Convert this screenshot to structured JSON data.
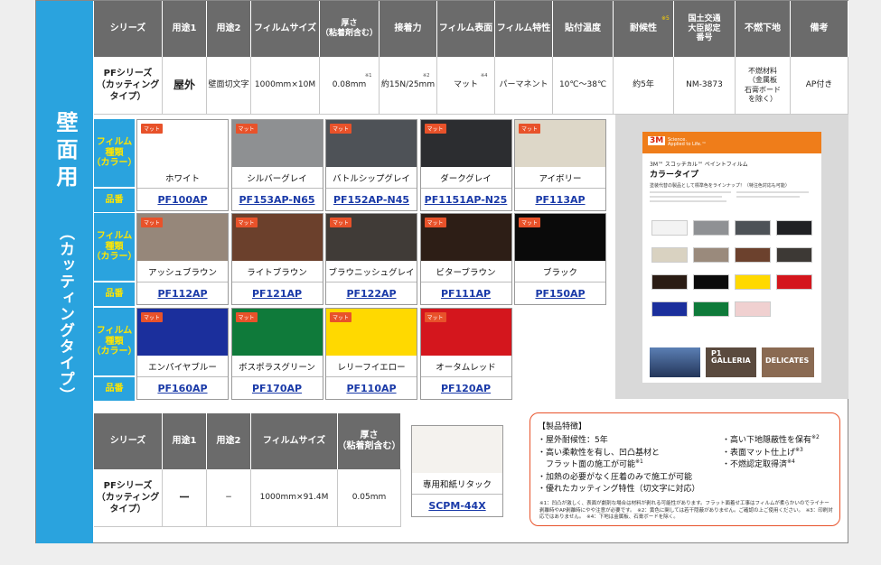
{
  "sidebar": {
    "title": "壁面用",
    "subtitle": "（カッティングタイプ）"
  },
  "spec_table": {
    "headers": [
      {
        "label": "シリーズ"
      },
      {
        "label": "用途1"
      },
      {
        "label": "用途2"
      },
      {
        "label": "フィルムサイズ"
      },
      {
        "label": "厚さ\n（粘着剤含む）"
      },
      {
        "label": "接着力"
      },
      {
        "label": "フィルム表面"
      },
      {
        "label": "フィルム特性"
      },
      {
        "label": "貼付温度"
      },
      {
        "label": "耐候性",
        "mark": "※5"
      },
      {
        "label": "国土交通\n大臣認定\n番号"
      },
      {
        "label": "不燃下地"
      },
      {
        "label": "備考"
      }
    ],
    "row": [
      {
        "value": "PFシリーズ\n（カッティング\nタイプ）"
      },
      {
        "value": "屋外"
      },
      {
        "value": "壁面切文字"
      },
      {
        "value": "1000mm×10M"
      },
      {
        "value": "0.08mm",
        "mark": "※1"
      },
      {
        "value": "約15N/25mm",
        "mark": "※2"
      },
      {
        "value": "マット",
        "mark": "※4"
      },
      {
        "value": "パーマネント"
      },
      {
        "value": "10℃〜38℃"
      },
      {
        "value": "約5年"
      },
      {
        "value": "NM-3873"
      },
      {
        "value": "不燃材料\n（金属板\n石膏ボード\nを除く）"
      },
      {
        "value": "AP付き"
      }
    ]
  },
  "row_labels": {
    "color": "フィルム\n種類\n（カラー）",
    "code": "品番"
  },
  "swatches": [
    {
      "tag": "マット",
      "name": "ホワイト",
      "code": "PF100AP",
      "color": "#ffffff"
    },
    {
      "tag": "マット",
      "name": "シルバーグレイ",
      "code": "PF153AP-N65",
      "color": "#8e9092"
    },
    {
      "tag": "マット",
      "name": "バトルシップグレイ",
      "code": "PF152AP-N45",
      "color": "#4e5257"
    },
    {
      "tag": "マット",
      "name": "ダークグレイ",
      "code": "PF1151AP-N25",
      "color": "#2c2d30"
    },
    {
      "tag": "マット",
      "name": "アイボリー",
      "code": "PF113AP",
      "color": "#ddd7c8"
    },
    {
      "tag": "マット",
      "name": "アッシュブラウン",
      "code": "PF112AP",
      "color": "#96877a"
    },
    {
      "tag": "マット",
      "name": "ライトブラウン",
      "code": "PF121AP",
      "color": "#6b402c"
    },
    {
      "tag": "マット",
      "name": "ブラウニッシュグレイ",
      "code": "PF122AP",
      "color": "#403b37"
    },
    {
      "tag": "マット",
      "name": "ビターブラウン",
      "code": "PF111AP",
      "color": "#2d1e16"
    },
    {
      "tag": "マット",
      "name": "ブラック",
      "code": "PF150AP",
      "color": "#0a0a0a"
    },
    {
      "tag": "マット",
      "name": "エンパイヤブルー",
      "code": "PF160AP",
      "color": "#1b2f9c"
    },
    {
      "tag": "マット",
      "name": "ボスポラスグリーン",
      "code": "PF170AP",
      "color": "#0f7a3a"
    },
    {
      "tag": "マット",
      "name": "レリーフイエロー",
      "code": "PF110AP",
      "color": "#ffd900"
    },
    {
      "tag": "マット",
      "name": "オータムレッド",
      "code": "PF120AP",
      "color": "#d4161d"
    }
  ],
  "catalog": {
    "logo": "3M",
    "tagline": "Science.\nApplied to Life.™",
    "line1": "3M™ スコッチカル™ ペイントフィルム",
    "title": "カラータイプ",
    "line2": "塗装代替の製品として標準色をラインナップ！（特注色対応も可能）",
    "photo2": "P1\nGALLERIA",
    "photo3": "DELICATES",
    "chips": [
      "#f3f3f3",
      "#8f9194",
      "#4d5257",
      "#202124",
      "#d9d2c1",
      "#9a8a7c",
      "#6c412d",
      "#3d3935",
      "#2a1c14",
      "#0b0b0b",
      "#ffd900",
      "#d4161d",
      "#1b2f9c",
      "#0f7a3a",
      "#f0d0d0"
    ]
  },
  "paper_table": {
    "headers": [
      "シリーズ",
      "用途1",
      "用途2",
      "フィルムサイズ",
      "厚さ\n（粘着剤含む）"
    ],
    "row": [
      "PFシリーズ\n（カッティング\nタイプ）",
      "ー",
      "−",
      "1000mm×91.4M",
      "0.05mm"
    ],
    "item_name": "専用和紙リタック",
    "item_code": "SCPM-44X",
    "item_color": "#f4f2ee"
  },
  "features": {
    "title": "【製品特徴】",
    "left": [
      {
        "text": "・屋外耐候性：5年"
      },
      {
        "text": "・高い柔軟性を有し、凹凸基材と"
      },
      {
        "text": "　フラット面の施工が可能",
        "mark": "※1"
      },
      {
        "text": "・加熱の必要がなく圧着のみで施工が可能"
      },
      {
        "text": "・優れたカッティング特性（切文字に対応）"
      }
    ],
    "right": [
      {
        "text": "・高い下地隠蔽性を保有",
        "mark": "※2"
      },
      {
        "text": "・表面マット仕上げ",
        "mark": "※3"
      },
      {
        "text": "・不燃認定取得済",
        "mark": "※4"
      }
    ],
    "notes": "※1：凹凸が激しく、表面が劇剤な場合は材料が剥れる可能性があります。フラット面着せ工事はフィルムが柔らかいのでライナー剥離時やAP剥離時にやや注意が必要です。　※2：黄色に関しては若干隠蔽がありません。ご確認の上ご使用ください。　※3：印刷対応ではありません。　※4：下地は金属板、石膏ボードを除く。"
  },
  "colors": {
    "accent": "#2aa3de",
    "header": "#6b6b6b",
    "code_text": "#1a3aa8",
    "tag": "#e8522a",
    "feature_border": "#e8522a"
  }
}
